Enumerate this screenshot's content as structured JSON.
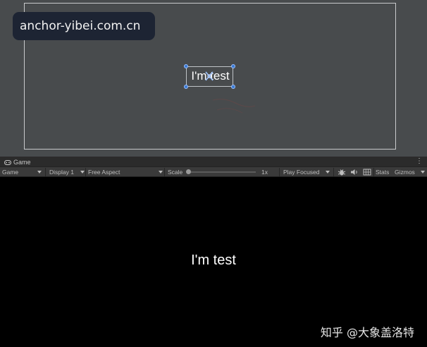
{
  "watermark": {
    "site": "anchor-yibei.com.cn",
    "zhihu": "知乎 @大象盖洛特"
  },
  "scene": {
    "selected_text": "I'm test"
  },
  "game_view": {
    "tab_label": "Game",
    "toolbar": {
      "mode": "Game",
      "display": "Display 1",
      "aspect": "Free Aspect",
      "scale_label": "Scale",
      "scale_value": "1x",
      "play_mode": "Play Focused",
      "stats": "Stats",
      "gizmos": "Gizmos"
    },
    "content_text": "I'm test"
  },
  "colors": {
    "scene_bg": "#484b4d",
    "game_bg": "#000000",
    "handle": "#3a7bd5",
    "toolbar_bg": "#3a3a3a"
  },
  "icons": [
    "gamepad-icon",
    "kebab-menu-icon",
    "bug-icon",
    "speaker-icon",
    "grid-icon"
  ]
}
